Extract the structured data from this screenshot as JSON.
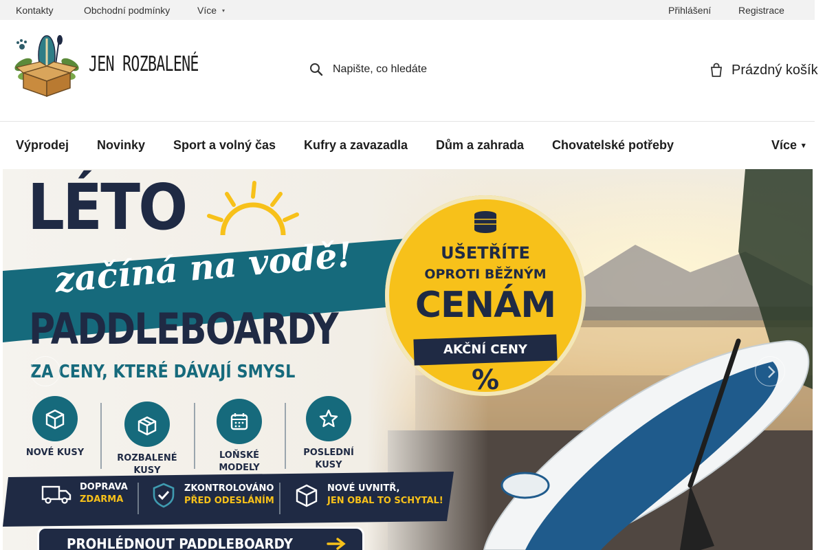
{
  "topbar": {
    "contacts": "Kontakty",
    "terms": "Obchodní podmínky",
    "more": "Více",
    "login": "Přihlášení",
    "register": "Registrace"
  },
  "header": {
    "logo_text": "JEN ROZBALENÉ",
    "search_placeholder": "Napište, co hledáte",
    "cart_label": "Prázdný košík"
  },
  "nav": {
    "items": [
      "Výprodej",
      "Novinky",
      "Sport a volný čas",
      "Kufry a zavazadla",
      "Dům a zahrada",
      "Chovatelské potřeby"
    ],
    "more": "Více"
  },
  "banner": {
    "title": "LÉTO",
    "subtitle_script": "začíná na vodě!",
    "headline": "PADDLEBOARDY",
    "tagline": "ZA CENY, KTERÉ DÁVAJÍ SMYSL",
    "badges": [
      {
        "line1": "NOVÉ KUSY",
        "line2": "",
        "icon": "box-icon"
      },
      {
        "line1": "ROZBALENÉ",
        "line2": "KUSY",
        "icon": "open-box-icon"
      },
      {
        "line1": "LOŇSKÉ",
        "line2": "MODELY",
        "icon": "calendar-icon"
      },
      {
        "line1": "POSLEDNÍ",
        "line2": "KUSY",
        "icon": "star-icon"
      }
    ],
    "strip": [
      {
        "line1": "DOPRAVA",
        "line2": "ZDARMA",
        "icon": "truck-icon"
      },
      {
        "line1": "ZKONTROLOVÁNO",
        "line2": "PŘED ODESLÁNÍM",
        "icon": "shield-check-icon"
      },
      {
        "line1": "NOVÉ UVNITŘ,",
        "line2": "JEN OBAL TO SCHYTAL!",
        "icon": "package-icon"
      }
    ],
    "cta": "PROHLÉDNOUT PADDLEBOARDY",
    "promo": {
      "line1": "UŠETŘÍTE",
      "line2": "OPROTI BĚŽNÝM",
      "line3": "CENÁM",
      "ribbon": "AKČNÍ CENY",
      "percent": "%"
    }
  },
  "colors": {
    "navy": "#1f2a44",
    "teal": "#166a7c",
    "yellow": "#f7c11a",
    "topbar_bg": "#f2f2f2"
  }
}
